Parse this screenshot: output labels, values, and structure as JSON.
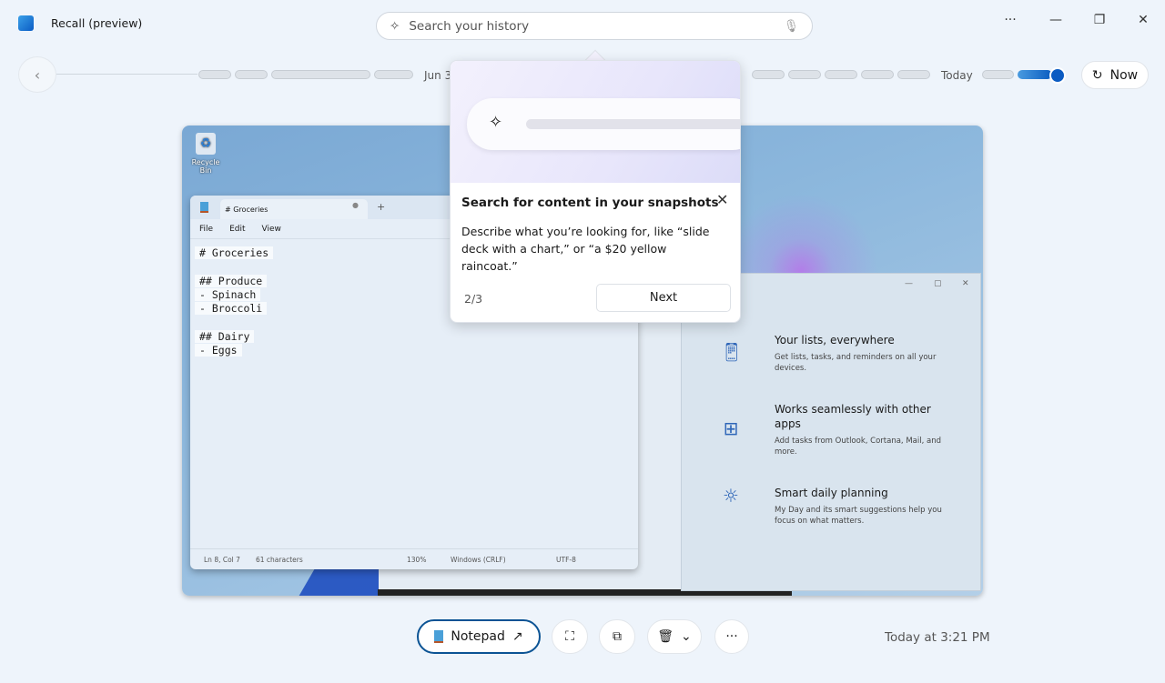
{
  "app": {
    "title": "Recall (preview)",
    "icon": "recall-app-icon"
  },
  "search": {
    "placeholder": "Search your history",
    "icon": "copilot-search-icon",
    "mic_icon": "mic-off-icon"
  },
  "window_controls": {
    "more": "···",
    "minimize": "—",
    "restore": "❐",
    "close": "✕"
  },
  "timeline": {
    "labels": [
      "Jun 3",
      "Today"
    ],
    "now_label": "Now",
    "position_percent": 100
  },
  "snapshot": {
    "desktop": {
      "recycle_bin": "Recycle Bin"
    },
    "notepad": {
      "tab": "# Groceries",
      "menu": [
        "File",
        "Edit",
        "View"
      ],
      "lines": [
        "# Groceries",
        "",
        "## Produce",
        "- Spinach",
        "- Broccoli",
        "",
        "## Dairy",
        "- Eggs"
      ],
      "status": [
        "Ln 8, Col 7",
        "61 characters",
        "130%",
        "Windows (CRLF)",
        "UTF-8"
      ]
    },
    "todo": {
      "features": [
        {
          "title": "Your lists, everywhere",
          "desc": "Get lists, tasks, and reminders on all your devices.",
          "icon": "phone-check-icon"
        },
        {
          "title": "Works seamlessly with other apps",
          "desc": "Add tasks from Outlook, Cortana, Mail, and more.",
          "icon": "windows-logo-icon"
        },
        {
          "title": "Smart daily planning",
          "desc": "My Day and its smart suggestions help you focus on what matters.",
          "icon": "sun-icon"
        }
      ]
    }
  },
  "popup": {
    "title": "Search for content in your snapshots",
    "description": "Describe what you’re looking for, like “slide deck with a chart,” or “a $20 yellow raincoat.”",
    "step": "2/3",
    "next_label": "Next"
  },
  "toolbar": {
    "app_label": "Notepad",
    "timestamp": "Today at 3:21 PM"
  }
}
